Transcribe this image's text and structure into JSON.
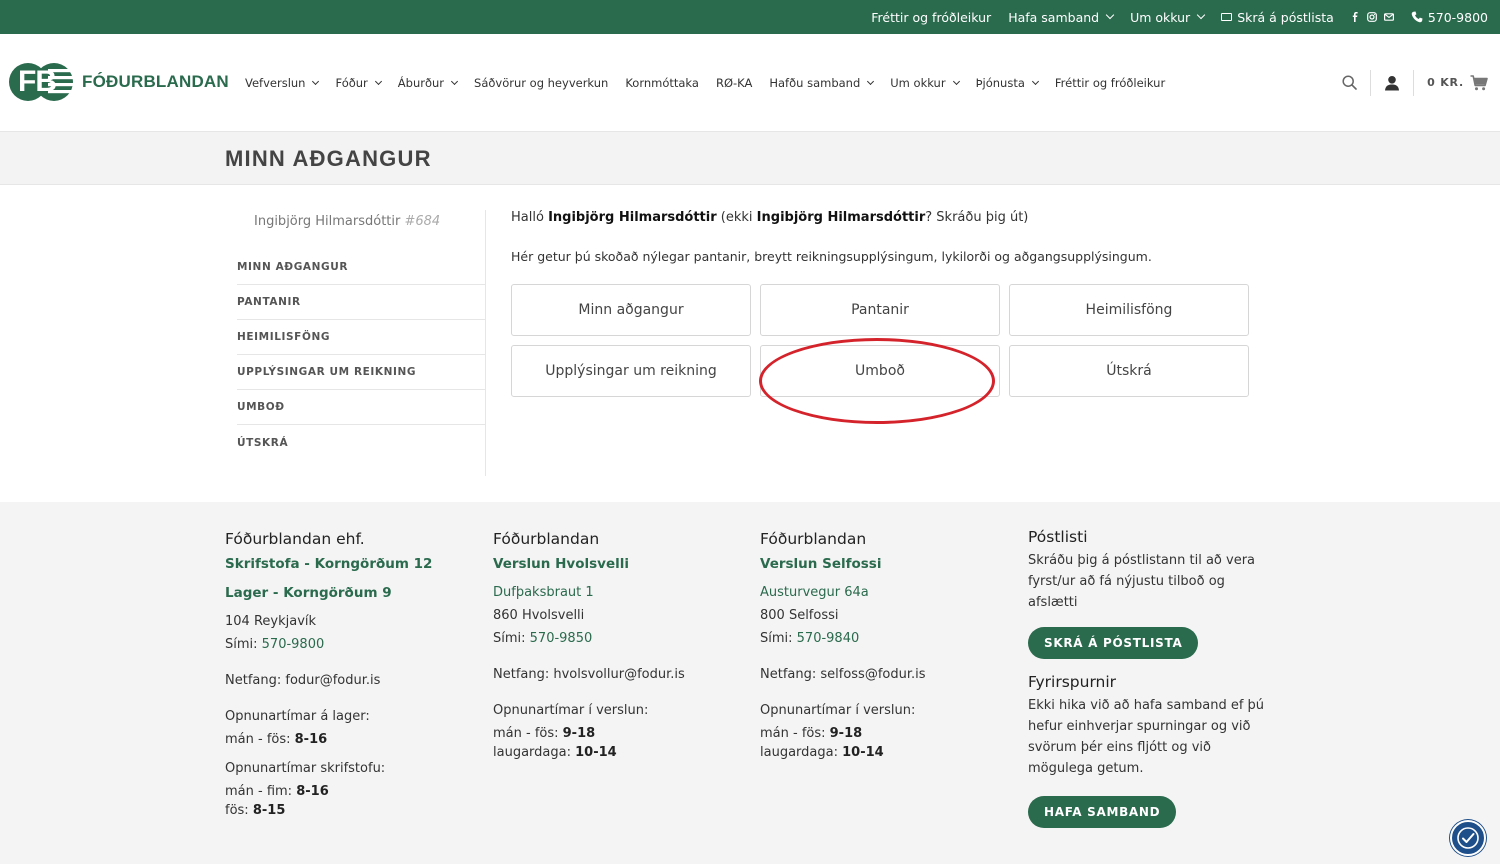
{
  "topbar": {
    "items": [
      {
        "label": "Fréttir og fróðleikur",
        "has_chevron": false
      },
      {
        "label": "Hafa samband",
        "has_chevron": true
      },
      {
        "label": "Um okkur",
        "has_chevron": true
      }
    ],
    "newsletter": "Skrá á póstlista",
    "phone": "570-9800",
    "social_icons": [
      "facebook-icon",
      "instagram-icon",
      "envelope-icon"
    ],
    "bg_color": "#2a6a4d"
  },
  "header": {
    "logo_letters": "FB",
    "logo_text": "FÓÐURBLANDAN",
    "nav": [
      {
        "label": "Vefverslun",
        "has_chevron": true
      },
      {
        "label": "Fóður",
        "has_chevron": true
      },
      {
        "label": "Áburður",
        "has_chevron": true
      },
      {
        "label": "Sáðvörur og heyverkun",
        "has_chevron": false
      },
      {
        "label": "Kornmóttaka",
        "has_chevron": false
      },
      {
        "label": "RØ-KA",
        "has_chevron": false
      },
      {
        "label": "Hafðu samband",
        "has_chevron": true
      },
      {
        "label": "Um okkur",
        "has_chevron": true
      },
      {
        "label": "Þjónusta",
        "has_chevron": true
      },
      {
        "label": "Fréttir og fróðleikur",
        "has_chevron": false
      }
    ],
    "cart_total": "0 KR."
  },
  "page": {
    "title": "MINN AÐGANGUR"
  },
  "sidebar": {
    "user_name": "Ingibjörg Hilmarsdóttir",
    "user_id": "#684",
    "items": [
      "MINN AÐGANGUR",
      "PANTANIR",
      "HEIMILISFÖNG",
      "UPPLÝSINGAR UM REIKNING",
      "UMBOÐ",
      "ÚTSKRÁ"
    ]
  },
  "content": {
    "hello_prefix": "Halló ",
    "hello_name": "Ingibjörg Hilmarsdóttir",
    "hello_mid": " (ekki ",
    "hello_name2": "Ingibjörg Hilmarsdóttir",
    "hello_suffix": "? Skráðu þig út)",
    "description": "Hér getur þú skoðað nýlegar pantanir, breytt reikningsupplýsingum, lykilorði og aðgangsupplýsingum.",
    "tiles": [
      "Minn aðgangur",
      "Pantanir",
      "Heimilisföng",
      "Upplýsingar um reikning",
      "Umboð",
      "Útskrá"
    ],
    "highlighted_tile": "Umboð",
    "highlight_color": "#d4232b"
  },
  "footer": {
    "col1": {
      "title": "Fóðurblandan ehf.",
      "link1": "Skrifstofa - Korngörðum 12",
      "link2": "Lager - Korngörðum 9",
      "postal": "104 Reykjavík",
      "phone_label": "Sími: ",
      "phone": "570-9800",
      "email": "Netfang: fodur@fodur.is",
      "hours1_title": "Opnunartímar á lager:",
      "hours1_days": "mán - fös: ",
      "hours1_time": "8-16",
      "hours2_title": "Opnunartímar skrifstofu:",
      "hours2_days1": "mán - fim: ",
      "hours2_time1": "8-16",
      "hours2_days2": "fös: ",
      "hours2_time2": "8-15"
    },
    "col2": {
      "title": "Fóðurblandan",
      "store": "Verslun Hvolsvelli",
      "street": "Dufþaksbraut 1",
      "postal": "860 Hvolsvelli",
      "phone_label": "Sími: ",
      "phone": "570-9850",
      "email": "Netfang: hvolsvollur@fodur.is",
      "hours_title": "Opnunartímar í verslun:",
      "days1": "mán - fös: ",
      "time1": "9-18",
      "days2": "laugardaga: ",
      "time2": "10-14"
    },
    "col3": {
      "title": "Fóðurblandan",
      "store": "Verslun Selfossi",
      "street": "Austurvegur 64a",
      "postal": "800 Selfossi",
      "phone_label": "Sími: ",
      "phone": "570-9840",
      "email": "Netfang: selfoss@fodur.is",
      "hours_title": "Opnunartímar í verslun:",
      "days1": "mán - fös: ",
      "time1": "9-18",
      "days2": "laugardaga: ",
      "time2": "10-14"
    },
    "col4": {
      "title1": "Póstlisti",
      "text1": "Skráðu þig á póstlistann til að vera fyrst/ur að fá nýjustu tilboð og afslætti",
      "button1": "SKRÁ Á PÓSTLISTA",
      "title2": "Fyrirspurnir",
      "text2": "Ekki hika við að hafa samband ef þú hefur einhverjar spurningar og við svörum þér eins fljótt og við mögulega getum.",
      "button2": "HAFA SAMBAND"
    }
  }
}
